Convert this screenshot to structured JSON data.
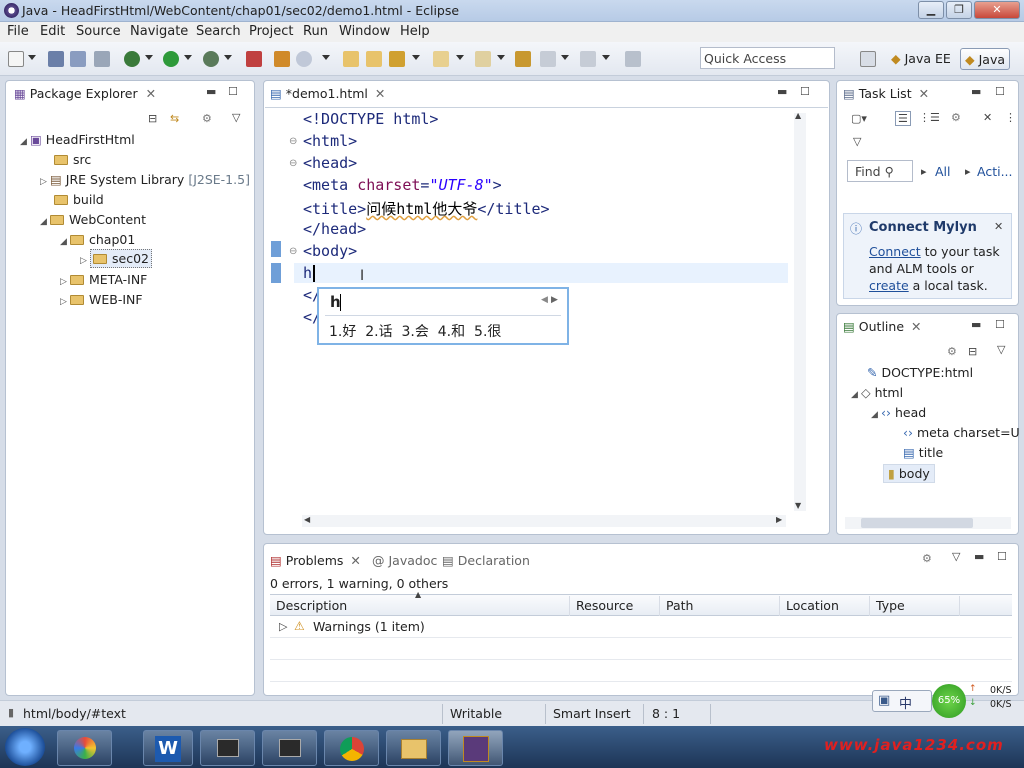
{
  "window": {
    "title": "Java - HeadFirstHtml/WebContent/chap01/sec02/demo1.html - Eclipse"
  },
  "menu": [
    "File",
    "Edit",
    "Source",
    "Navigate",
    "Search",
    "Project",
    "Run",
    "Window",
    "Help"
  ],
  "quick_access": "Quick Access",
  "perspectives": [
    "Java EE",
    "Java"
  ],
  "package_explorer": {
    "tab": "Package Explorer",
    "tree": {
      "project": "HeadFirstHtml",
      "src": "src",
      "jre": "JRE System Library",
      "jre_tag": "[J2SE-1.5]",
      "build": "build",
      "webcontent": "WebContent",
      "chap01": "chap01",
      "sec02": "sec02",
      "metainf": "META-INF",
      "webinf": "WEB-INF"
    }
  },
  "editor": {
    "tab": "*demo1.html",
    "lines": {
      "l1": "<!DOCTYPE html>",
      "l2": "<html>",
      "l3": "<head>",
      "l4a": "<meta ",
      "l4b": "charset",
      "l4c": "=",
      "l4d": "\"UTF-8\"",
      "l4e": ">",
      "l5a": "<title>",
      "l5b": "问候html他大爷",
      "l5c": "</title>",
      "l6": "</head>",
      "l7": "<body>",
      "l8": "h",
      "l9": "</",
      "l10": "</"
    }
  },
  "ime": {
    "composition": "h",
    "candidates": "1.好  2.话  3.会  4.和  5.很"
  },
  "task_list": {
    "tab": "Task List",
    "find": "Find",
    "all": "All",
    "activate": "Acti..."
  },
  "mylyn": {
    "title": "Connect Mylyn",
    "connect_link": "Connect",
    "line1_rest": " to your task",
    "line2": "and ALM tools or",
    "create_link": "create",
    "line3_rest": " a local task."
  },
  "outline": {
    "tab": "Outline",
    "items": {
      "doctype": "DOCTYPE:html",
      "html": "html",
      "head": "head",
      "meta": "meta charset=U",
      "title": "title",
      "body": "body"
    }
  },
  "problems": {
    "tabs": [
      "Problems",
      "Javadoc",
      "Declaration"
    ],
    "summary": "0 errors, 1 warning, 0 others",
    "columns": [
      "Description",
      "Resource",
      "Path",
      "Location",
      "Type"
    ],
    "rows": [
      {
        "description": "Warnings (1 item)"
      }
    ]
  },
  "status": {
    "path": "html/body/#text",
    "writable": "Writable",
    "insert": "Smart Insert",
    "position": "8 : 1"
  },
  "tray": {
    "ime": "中",
    "battery": "65%",
    "up": "0K/S",
    "down": "0K/S",
    "watermark": "www.java1234.com"
  }
}
